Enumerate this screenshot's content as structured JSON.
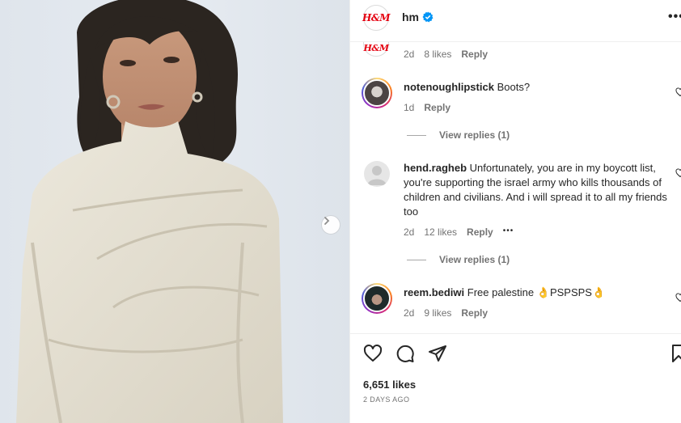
{
  "post": {
    "username": "hm",
    "brand_logo_text": "H&M"
  },
  "comments": [
    {
      "text": "",
      "time": "2d",
      "likes": "8 likes",
      "reply": "Reply"
    },
    {
      "username": "notenoughlipstick",
      "text": "Boots?",
      "time": "1d",
      "reply": "Reply",
      "view_replies": "View replies (1)"
    },
    {
      "username": "hend.ragheb",
      "text": "Unfortunately, you are in my boycott list, you're supporting the israel army who kills thousands of children and civilians. And i will spread it to all my friends too",
      "time": "2d",
      "likes": "12 likes",
      "reply": "Reply",
      "more": "•••",
      "view_replies": "View replies (1)"
    },
    {
      "username": "reem.bediwi",
      "text": "Free palestine 👌PSPSPS👌",
      "time": "2d",
      "likes": "9 likes",
      "reply": "Reply"
    }
  ],
  "footer": {
    "likes": "6,651 likes",
    "date": "2 DAYS AGO"
  },
  "icons": {
    "verified": "verified-badge-icon",
    "like": "heart-icon",
    "comment": "comment-icon",
    "share": "send-icon",
    "save": "bookmark-icon",
    "next": "chevron-right-icon"
  },
  "colors": {
    "verified": "#0095f6",
    "brand": "#e50010",
    "muted": "#737373"
  }
}
